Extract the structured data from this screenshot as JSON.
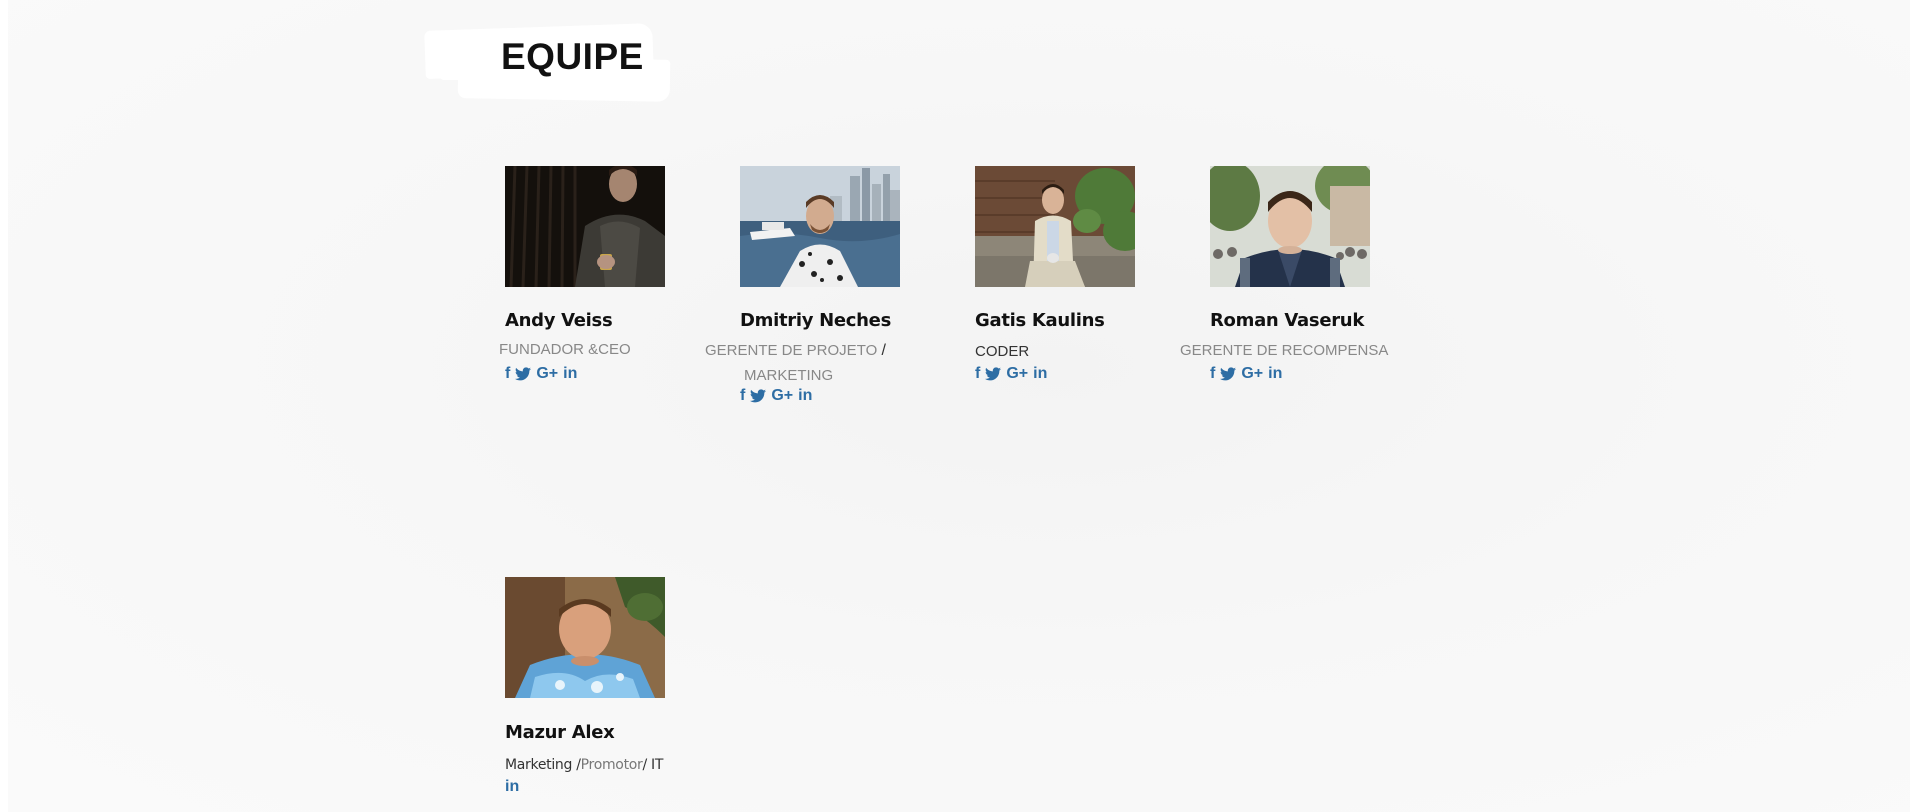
{
  "header": {
    "title": "EQUIPE"
  },
  "colors": {
    "link": "#2d6da4",
    "role_text": "#888888",
    "background": "#f6f6f6"
  },
  "icons": {
    "facebook": "f",
    "twitter": "twitter-bird-icon",
    "google_plus": "G+",
    "linkedin": "in"
  },
  "team": [
    {
      "name": "Andy Veiss",
      "role": "FUNDADOR &CEO",
      "photo": "man-dark-shirt-watch-photo",
      "socials": [
        "facebook",
        "twitter",
        "google-plus",
        "linkedin"
      ]
    },
    {
      "name": "Dmitriy Neches",
      "role_line1": "GERENTE DE PROJETO",
      "role_slash": "/",
      "role_line2": "MARKETING",
      "photo": "man-boat-harbor-skyline-photo",
      "socials": [
        "facebook",
        "twitter",
        "google-plus",
        "linkedin"
      ]
    },
    {
      "name": "Gatis Kaulins",
      "role": "CODER",
      "photo": "man-suit-sitting-photo",
      "socials": [
        "facebook",
        "twitter",
        "google-plus",
        "linkedin"
      ]
    },
    {
      "name": "Roman Vaseruk",
      "role": "GERENTE DE RECOMPENSA",
      "photo": "young-man-street-photo",
      "socials": [
        "facebook",
        "twitter",
        "google-plus",
        "linkedin"
      ]
    },
    {
      "name": "Mazur Alex",
      "role_part1": "Marketing /",
      "role_part2": "Promotor",
      "role_part3": "/ IT",
      "photo": "man-blue-shirt-photo",
      "socials": [
        "linkedin"
      ]
    }
  ]
}
